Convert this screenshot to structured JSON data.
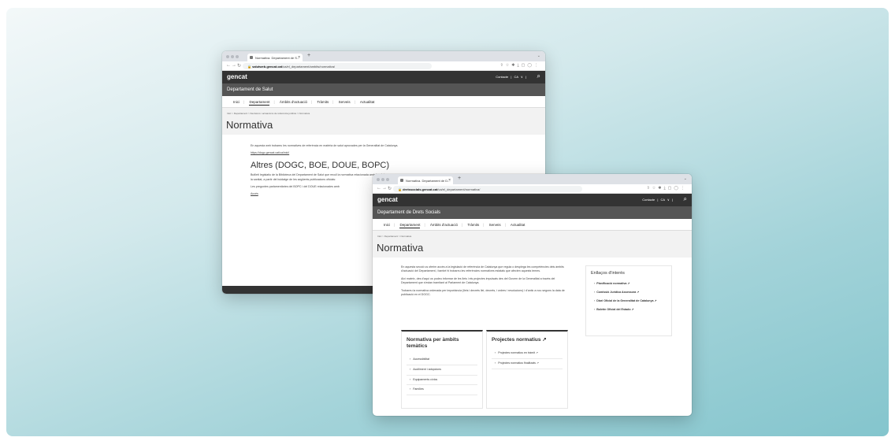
{
  "back_window": {
    "tab_title": "Normativa. Departament de S...",
    "url_domain": "salutweb.gencat.cat",
    "url_path": "/ca/el_departament/ambits/normativa/",
    "logo": "gencat",
    "top_links": "Contacte  |  CA ∨  |",
    "department": "Departament de Salut",
    "menu": [
      "Inici",
      "Departament",
      "Àmbits d'actuació",
      "Tràmits",
      "Serveis",
      "Actualitat"
    ],
    "breadcrumb": "Inici  >  Departament  >  Decisions i actuacions de referència jurídica  >  Normativa",
    "title": "Normativa",
    "intro": "En aquesta web trobareu les normatives de referència en matèria de salut aprovades per la Generalitat de Catalunya.",
    "intro_link": "https://dogc.gencat.cat/ca/inici/",
    "section_title": "Altres (DOGC, BOE, DOUE, BOPC)",
    "section_p1": "Butlletí legislatiu de la Biblioteca del Departament de Salut que recull la normativa relacionada amb la salut,",
    "section_p1b": "la sanitat, a partir del buidatge de les següents publicacions oficials:",
    "section_p2": "Les preguntes parlamentàries del BOPC i del DOUE relacionades amb",
    "section_link": "Accés"
  },
  "front_window": {
    "tab_title": "Normativa. Departament de D...",
    "url_domain": "dretssocials.gencat.cat",
    "url_path": "/ca/el_departament/normativa/",
    "logo": "gencat",
    "top_links": "Contacte  |  CA ∨  |",
    "department": "Departament de Drets Socials",
    "menu": [
      "Inici",
      "Departament",
      "Àmbits d'actuació",
      "Tràmits",
      "Serveis",
      "Actualitat"
    ],
    "breadcrumb": "Inici  >  Departament  >  Normativa",
    "title": "Normativa",
    "para1": "En aquesta secció us oferim accés a la legislació de referència de Catalunya que regula o desplega les competències dels àmbits d'actuació del Departament, i també hi trobareu les referències normatives estatals que afecten aquests temes.",
    "para2": "Així mateix, des d'aquí us podeu informar de les lleis i els projectes impulsats des del Govern de la Generalitat a través del Departament que s'estan tramitant al Parlament de Catalunya.",
    "para3": "Trobareu la normativa ordenada per importància (lleis i decrets llei, decrets, i ordres i resolucions) i d'antic a nou segons la data de publicació en el DOGC.",
    "card_a": {
      "title": "Normativa per àmbits temàtics",
      "items": [
        "Accessibilitat",
        "Acolliment i adopcions",
        "Equipaments cívics",
        "Famílies"
      ]
    },
    "card_b": {
      "title": "Projectes normatius ↗",
      "items": [
        "Projectes normatius en tràmit ↗",
        "Projectes normatius finalitzats ↗"
      ]
    },
    "side_box": {
      "title": "Enllaços d'interès",
      "items": [
        "Planificació normativa ↗",
        "Comissió Jurídica Assessora ↗",
        "Diari Oficial de la Generalitat de Catalunya ↗",
        "Boletín Oficial del Estado ↗"
      ]
    }
  },
  "colors": {
    "header": "#333333",
    "dept_bar": "#555555",
    "background_accent": "#84c5cd"
  }
}
